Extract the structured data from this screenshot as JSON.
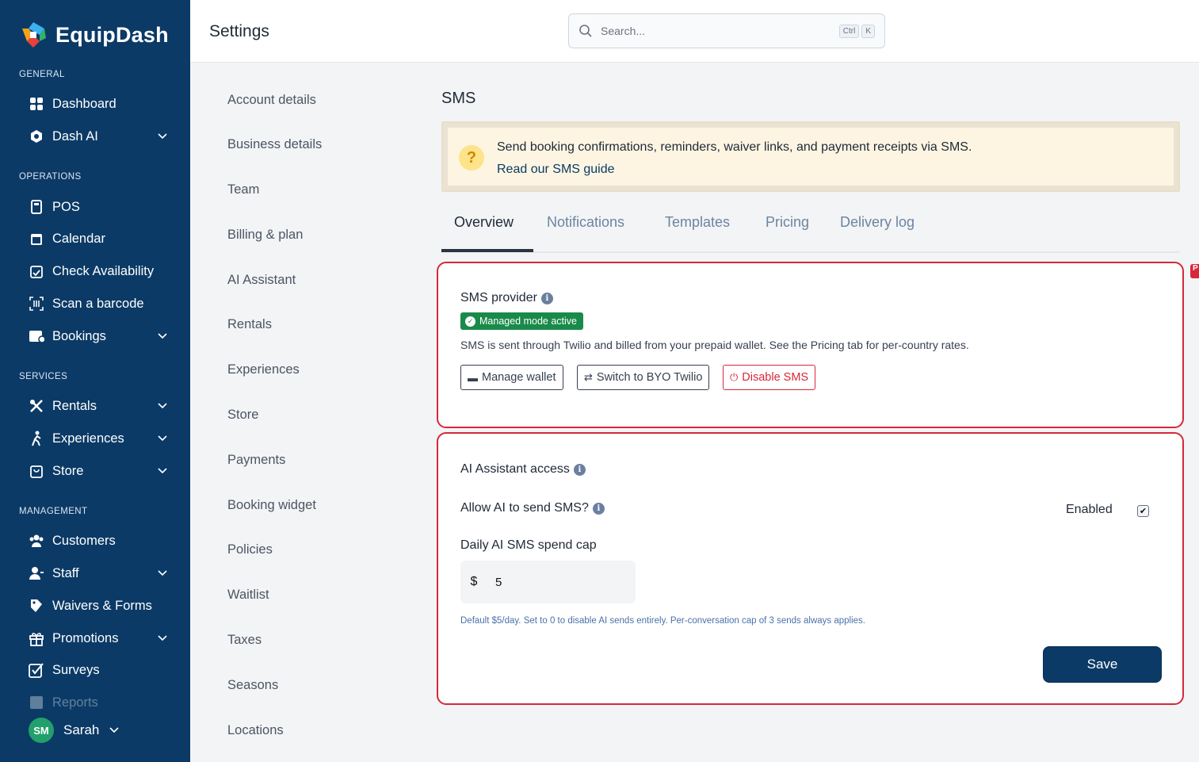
{
  "brand": {
    "name": "EquipDash"
  },
  "sidebar": {
    "sections": [
      "GENERAL",
      "OPERATIONS",
      "SERVICES",
      "MANAGEMENT"
    ],
    "items": [
      {
        "label": "Dashboard",
        "icon": "dashboard-icon"
      },
      {
        "label": "Dash AI",
        "icon": "dash-ai-icon"
      },
      {
        "label": "POS",
        "icon": "pos-icon"
      },
      {
        "label": "Calendar",
        "icon": "calendar-icon"
      },
      {
        "label": "Check Availability",
        "icon": "calendar-check-icon"
      },
      {
        "label": "Scan a barcode",
        "icon": "barcode-icon"
      },
      {
        "label": "Bookings",
        "icon": "bookings-icon"
      },
      {
        "label": "Rentals",
        "icon": "rentals-icon"
      },
      {
        "label": "Experiences",
        "icon": "experiences-icon"
      },
      {
        "label": "Store",
        "icon": "store-icon"
      },
      {
        "label": "Customers",
        "icon": "customers-icon"
      },
      {
        "label": "Staff",
        "icon": "staff-icon"
      },
      {
        "label": "Waivers & Forms",
        "icon": "waiver-icon"
      },
      {
        "label": "Promotions",
        "icon": "gift-icon"
      },
      {
        "label": "Surveys",
        "icon": "survey-icon"
      },
      {
        "label": "Reports",
        "icon": "reports-icon"
      }
    ],
    "user": {
      "initials": "SM",
      "name": "Sarah"
    }
  },
  "header": {
    "title": "Settings",
    "search_placeholder": "Search...",
    "shortcut_ctrl": "Ctrl",
    "shortcut_key": "K"
  },
  "settings_nav": [
    "Account details",
    "Business details",
    "Team",
    "Billing & plan",
    "AI Assistant",
    "Rentals",
    "Experiences",
    "Store",
    "Payments",
    "Booking widget",
    "Policies",
    "Waitlist",
    "Taxes",
    "Seasons",
    "Locations"
  ],
  "main": {
    "title": "SMS",
    "banner": {
      "text": "Send booking confirmations, reminders, waiver links, and payment receipts via SMS.",
      "link": "Read our SMS guide"
    },
    "tabs": [
      "Overview",
      "Notifications",
      "Templates",
      "Pricing",
      "Delivery log"
    ],
    "active_tab": "Overview",
    "provider_card": {
      "label": "SMS provider",
      "badge": "Managed mode active",
      "description": "SMS is sent through Twilio and billed from your prepaid wallet. See the Pricing tab for per-country rates.",
      "buttons": [
        "Manage wallet",
        "Switch to BYO Twilio",
        "Disable SMS"
      ]
    },
    "ai_card": {
      "label": "AI Assistant access",
      "allow_label": "Allow AI to send SMS?",
      "enabled_label": "Enabled",
      "enabled": true,
      "cap_label": "Daily AI SMS spend cap",
      "currency": "$",
      "cap_value": "5",
      "hint": "Default $5/day. Set to 0 to disable AI sends entirely. Per-conversation cap of 3 sends always applies.",
      "save_label": "Save"
    }
  },
  "colors": {
    "sidebar_bg": "#0b3a66",
    "accent_red": "#d62839",
    "badge_green": "#1a8a4a",
    "banner_bg": "#fdf5e2"
  }
}
